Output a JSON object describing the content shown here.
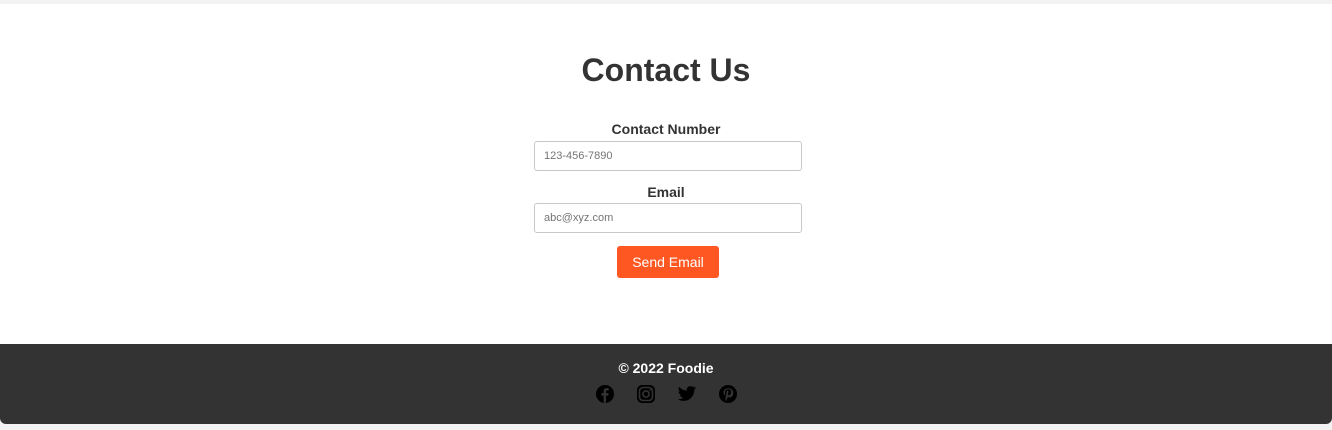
{
  "contact": {
    "title": "Contact Us",
    "contact_number_label": "Contact Number",
    "contact_number_placeholder": "123-456-7890",
    "email_label": "Email",
    "email_placeholder": "abc@xyz.com",
    "send_button_label": "Send Email"
  },
  "footer": {
    "copyright": "© 2022 Foodie",
    "social_icons": [
      "facebook-icon",
      "instagram-icon",
      "twitter-icon",
      "pinterest-icon"
    ]
  },
  "colors": {
    "accent": "#ff5722",
    "footer_background": "#333333",
    "text": "#333333"
  }
}
